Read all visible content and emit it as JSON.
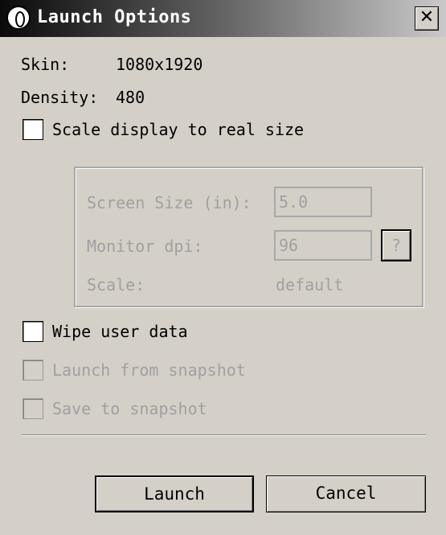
{
  "window": {
    "title": "Launch Options",
    "close_glyph": "✕",
    "icon": "app-icon"
  },
  "info": {
    "skin_label": "Skin:",
    "skin_value": "1080x1920",
    "density_label": "Density:",
    "density_value": "480"
  },
  "scale_display": {
    "label": "Scale display to real size",
    "checked": false
  },
  "scale_group": {
    "screen_size_label": "Screen Size (in):",
    "screen_size_value": "5.0",
    "monitor_dpi_label": "Monitor dpi:",
    "monitor_dpi_value": "96",
    "help_label": "?",
    "scale_label": "Scale:",
    "scale_value": "default"
  },
  "options": {
    "wipe_user_data": {
      "label": "Wipe user data",
      "checked": false,
      "enabled": true
    },
    "launch_from_snapshot": {
      "label": "Launch from snapshot",
      "checked": false,
      "enabled": false
    },
    "save_to_snapshot": {
      "label": "Save to snapshot",
      "checked": false,
      "enabled": false
    }
  },
  "buttons": {
    "launch": "Launch",
    "cancel": "Cancel"
  }
}
